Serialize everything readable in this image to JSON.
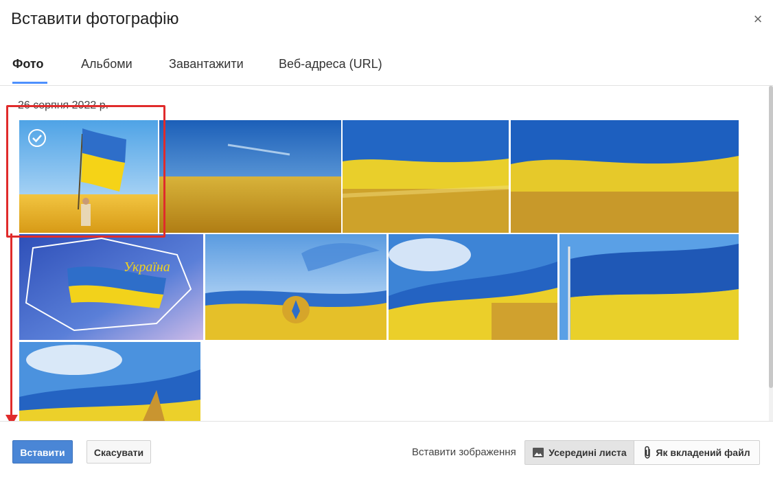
{
  "dialog": {
    "title": "Вставити фотографію",
    "close_glyph": "×"
  },
  "tabs": [
    {
      "label": "Фото",
      "active": true
    },
    {
      "label": "Альбоми",
      "active": false
    },
    {
      "label": "Завантажити",
      "active": false
    },
    {
      "label": "Веб-адреса (URL)",
      "active": false
    }
  ],
  "gallery": {
    "date_label": "26 серпня 2022 р.",
    "photos": [
      {
        "name": "flag-in-wheat-person",
        "selected": true
      },
      {
        "name": "wheat-field-sky",
        "selected": false
      },
      {
        "name": "flag-over-wheat-1",
        "selected": false
      },
      {
        "name": "flag-over-wheat-2",
        "selected": false
      },
      {
        "name": "ukraine-map-flag",
        "selected": false,
        "caption": "Україна"
      },
      {
        "name": "stork-coat-of-arms",
        "selected": false
      },
      {
        "name": "flag-wheat-clouds",
        "selected": false
      },
      {
        "name": "flag-on-pole-wheat",
        "selected": false
      },
      {
        "name": "flag-wheat-sky-partial",
        "selected": false
      }
    ]
  },
  "footer": {
    "insert_button": "Вставити",
    "cancel_button": "Скасувати",
    "insert_image_label": "Вставити зображення",
    "inline_option": "Усередині листа",
    "attachment_option": "Як вкладений файл"
  },
  "colors": {
    "accent": "#4d90fe",
    "primary_button": "#4a86d6",
    "highlight": "#e02b2b",
    "flag_blue": "#1f63c4",
    "flag_yellow": "#f2d21b"
  }
}
